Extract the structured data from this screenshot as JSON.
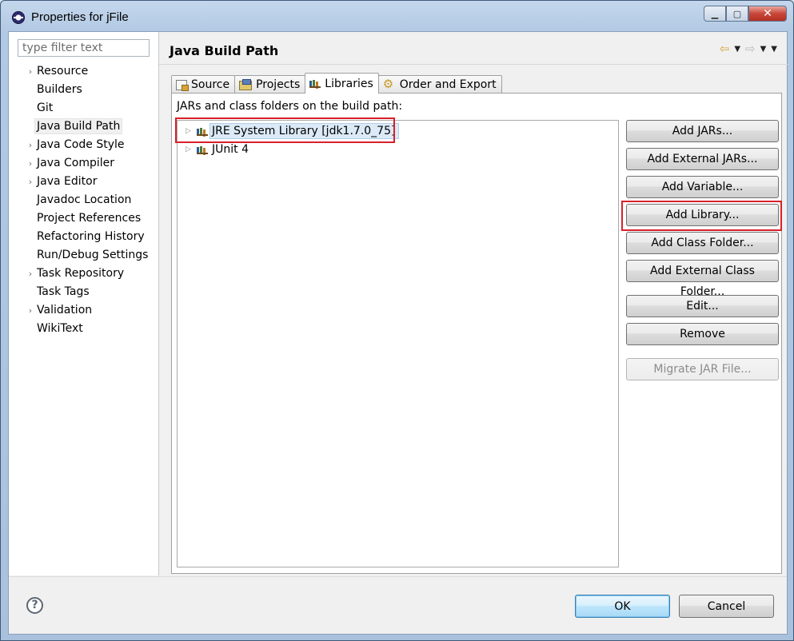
{
  "window": {
    "title": "Properties for jFile"
  },
  "filter": {
    "placeholder": "type filter text"
  },
  "nav": {
    "items": [
      {
        "label": "Resource",
        "expandable": true
      },
      {
        "label": "Builders",
        "expandable": false
      },
      {
        "label": "Git",
        "expandable": false
      },
      {
        "label": "Java Build Path",
        "expandable": false,
        "selected": true
      },
      {
        "label": "Java Code Style",
        "expandable": true
      },
      {
        "label": "Java Compiler",
        "expandable": true
      },
      {
        "label": "Java Editor",
        "expandable": true
      },
      {
        "label": "Javadoc Location",
        "expandable": false
      },
      {
        "label": "Project References",
        "expandable": false
      },
      {
        "label": "Refactoring History",
        "expandable": false
      },
      {
        "label": "Run/Debug Settings",
        "expandable": false
      },
      {
        "label": "Task Repository",
        "expandable": true
      },
      {
        "label": "Task Tags",
        "expandable": false
      },
      {
        "label": "Validation",
        "expandable": true
      },
      {
        "label": "WikiText",
        "expandable": false
      }
    ]
  },
  "page": {
    "title": "Java Build Path"
  },
  "tabs": [
    {
      "label": "Source",
      "icon": "source-folder-icon"
    },
    {
      "label": "Projects",
      "icon": "projects-icon"
    },
    {
      "label": "Libraries",
      "icon": "library-icon",
      "active": true
    },
    {
      "label": "Order and Export",
      "icon": "order-export-icon"
    }
  ],
  "libraries": {
    "caption": "JARs and class folders on the build path:",
    "tree": [
      {
        "label": "JRE System Library [jdk1.7.0_75]",
        "selected": true
      },
      {
        "label": "JUnit 4",
        "selected": false
      }
    ],
    "buttons": {
      "add_jars": "Add JARs...",
      "add_external_jars": "Add External JARs...",
      "add_variable": "Add Variable...",
      "add_library": "Add Library...",
      "add_class_folder": "Add Class Folder...",
      "add_external_class_folder": "Add External Class Folder...",
      "edit": "Edit...",
      "remove": "Remove",
      "migrate_jar": "Migrate JAR File..."
    }
  },
  "footer": {
    "help": "?",
    "ok": "OK",
    "cancel": "Cancel"
  },
  "colors": {
    "highlight_box": "#d8202a",
    "selection": "#dceaf7"
  }
}
